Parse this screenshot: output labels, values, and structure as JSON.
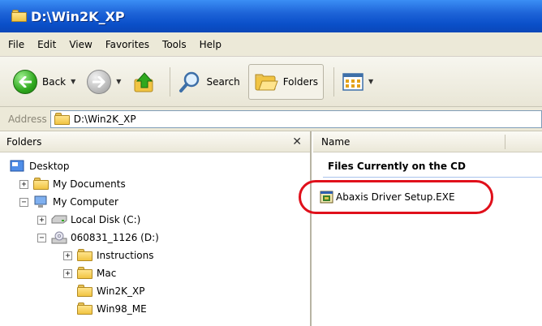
{
  "window": {
    "title": "D:\\Win2K_XP"
  },
  "menu": {
    "items": [
      "File",
      "Edit",
      "View",
      "Favorites",
      "Tools",
      "Help"
    ]
  },
  "toolbar": {
    "back_label": "Back",
    "search_label": "Search",
    "folders_label": "Folders"
  },
  "address": {
    "label": "Address",
    "value": "D:\\Win2K_XP"
  },
  "folders_pane": {
    "header": "Folders",
    "tree": [
      {
        "label": "Desktop"
      },
      {
        "label": "My Documents",
        "toggle": "+"
      },
      {
        "label": "My Computer",
        "toggle": "−"
      },
      {
        "label": "Local Disk (C:)",
        "toggle": "+"
      },
      {
        "label": "060831_1126 (D:)",
        "toggle": "−"
      },
      {
        "label": "Instructions",
        "toggle": "+"
      },
      {
        "label": "Mac",
        "toggle": "+"
      },
      {
        "label": "Win2K_XP"
      },
      {
        "label": "Win98_ME"
      }
    ]
  },
  "files_pane": {
    "column_name": "Name",
    "group_title": "Files Currently on the CD",
    "files": [
      {
        "name": "Abaxis Driver Setup.EXE"
      }
    ]
  },
  "colors": {
    "title_bar": "#0a4fc9",
    "highlight": "#e0101b",
    "chrome": "#ece9d8"
  }
}
